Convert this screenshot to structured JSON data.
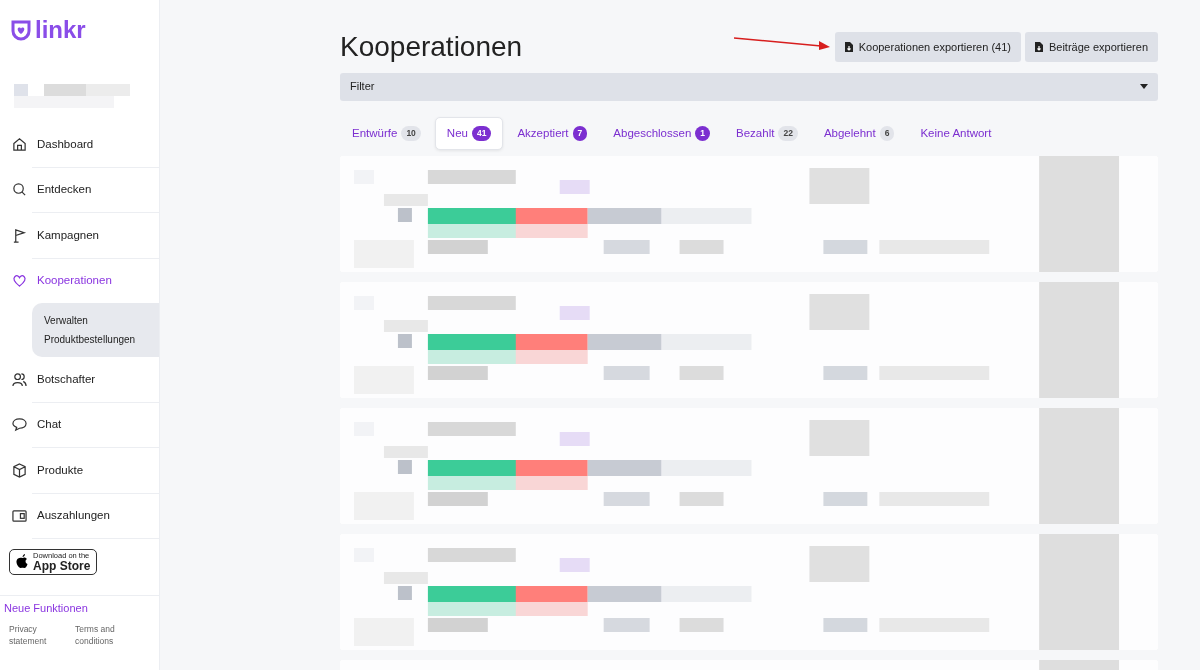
{
  "sidebar": {
    "logo": "linkr",
    "items": [
      {
        "label": "Dashboard",
        "selected": false
      },
      {
        "label": "Entdecken",
        "selected": false
      },
      {
        "label": "Kampagnen",
        "selected": false
      },
      {
        "label": "Kooperationen",
        "selected": true,
        "children": [
          {
            "label": "Verwalten"
          },
          {
            "label": "Produktbestellungen"
          }
        ]
      },
      {
        "label": "Botschafter",
        "selected": false
      },
      {
        "label": "Chat",
        "selected": false
      },
      {
        "label": "Produkte",
        "selected": false
      },
      {
        "label": "Auszahlungen",
        "selected": false
      }
    ],
    "app_store": {
      "small": "Download on the",
      "big": "App Store"
    },
    "news": "Neue Funktionen",
    "footer_links": [
      "Privacy statement",
      "Terms and conditions"
    ]
  },
  "page": {
    "title": "Kooperationen",
    "buttons": [
      "Kooperationen exportieren (41)",
      "Beiträge exportieren"
    ],
    "filter": "Filter",
    "tabs": [
      {
        "label": "Entwürfe",
        "count": "10",
        "color": "#e2e4ea",
        "selected": false
      },
      {
        "label": "Neu",
        "count": "41",
        "color": "#7c2fd0",
        "selected": true
      },
      {
        "label": "Akzeptiert",
        "count": "7",
        "color": "#7c2fd0",
        "selected": false
      },
      {
        "label": "Abgeschlossen",
        "count": "1",
        "color": "#7c2fd0",
        "selected": false
      },
      {
        "label": "Bezahlt",
        "count": "22",
        "color": "#e2e4ea",
        "selected": false
      },
      {
        "label": "Abgelehnt",
        "count": "6",
        "color": "#e2e4ea",
        "selected": false
      },
      {
        "label": "Keine Antwort",
        "selected": false
      }
    ]
  }
}
